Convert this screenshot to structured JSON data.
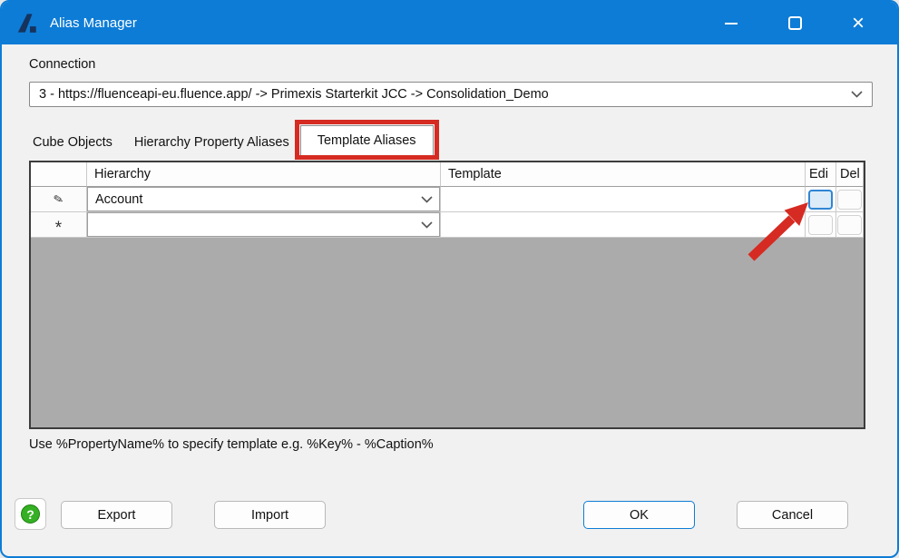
{
  "window": {
    "title": "Alias Manager"
  },
  "icons": {
    "app_logo": "fluence-a-logo",
    "minimize": "minimize-line",
    "maximize": "maximize-square",
    "close": "×",
    "dropdown_chevron": "chevron-down",
    "row_edit_indicator": "✎",
    "row_new_indicator": "*",
    "help": "?"
  },
  "connection": {
    "label": "Connection",
    "value": "3 - https://fluenceapi-eu.fluence.app/ -> Primexis Starterkit JCC -> Consolidation_Demo"
  },
  "tabs": [
    {
      "label": "Cube Objects",
      "active": false
    },
    {
      "label": "Hierarchy Property Aliases",
      "active": false
    },
    {
      "label": "Template Aliases",
      "active": true,
      "annotated": true
    }
  ],
  "grid": {
    "columns": {
      "row_header": "",
      "hierarchy": "Hierarchy",
      "template": "Template",
      "edit": "Edi",
      "delete": "Del"
    },
    "rows": [
      {
        "indicator": "✎",
        "hierarchy": "Account",
        "template": "",
        "edit_highlighted": true
      },
      {
        "indicator": "*",
        "hierarchy": "",
        "template": "",
        "edit_highlighted": false
      }
    ]
  },
  "hint": {
    "text": "Use %PropertyName% to specify template e.g. %Key% - %Caption%"
  },
  "footer": {
    "help_glyph": "?",
    "export": "Export",
    "import": "Import",
    "ok": "OK",
    "cancel": "Cancel"
  },
  "annotations": {
    "tab_outline_target": "Template Aliases tab",
    "arrow_target": "Edit button of Account row",
    "color": "#d52b22"
  },
  "colors": {
    "titlebar_blue": "#0d7cd6",
    "logo_navy": "#16335e",
    "dialog_bg": "#f1f1f1",
    "grid_empty_gray": "#ababab",
    "annotation_red": "#d52b22",
    "edit_button_fill": "#dcebf8",
    "edit_button_border": "#2f86d3",
    "help_green": "#35b024"
  }
}
